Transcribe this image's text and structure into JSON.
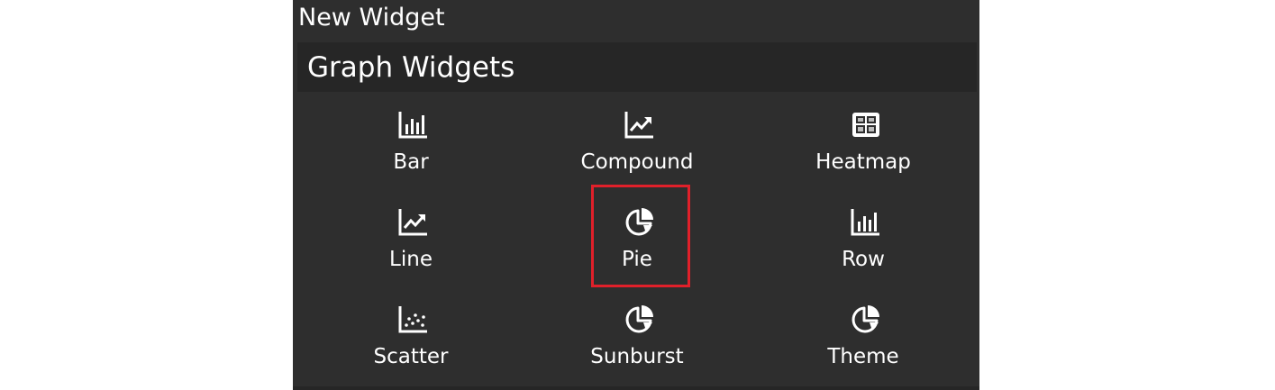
{
  "dialog": {
    "title": "New Widget"
  },
  "section": {
    "title": "Graph Widgets"
  },
  "widgets": [
    {
      "label": "Bar",
      "icon": "bar-chart-icon"
    },
    {
      "label": "Compound",
      "icon": "line-chart-icon"
    },
    {
      "label": "Heatmap",
      "icon": "heatmap-icon"
    },
    {
      "label": "Line",
      "icon": "line-chart-icon"
    },
    {
      "label": "Pie",
      "icon": "pie-chart-icon",
      "selected": true
    },
    {
      "label": "Row",
      "icon": "bar-chart-icon"
    },
    {
      "label": "Scatter",
      "icon": "scatter-chart-icon"
    },
    {
      "label": "Sunburst",
      "icon": "pie-chart-icon"
    },
    {
      "label": "Theme",
      "icon": "pie-chart-icon"
    }
  ],
  "colors": {
    "panel_bg": "#2e2e2e",
    "header_bg": "#262626",
    "text": "#ffffff",
    "selection_outline": "#e0202a"
  }
}
